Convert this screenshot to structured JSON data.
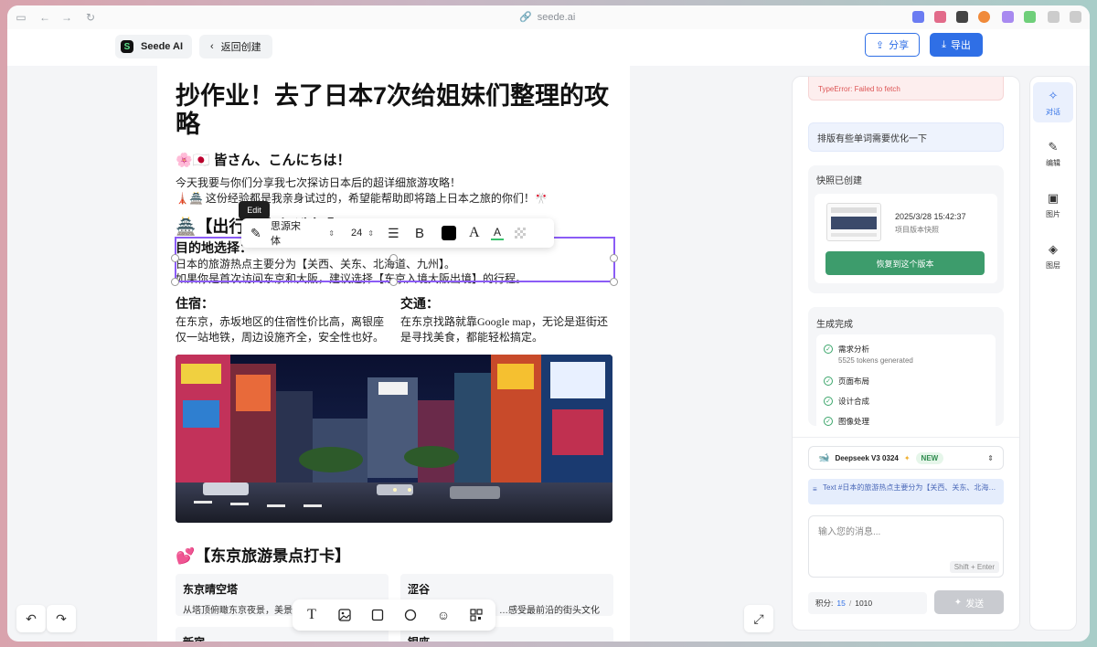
{
  "browser": {
    "url": "seede.ai"
  },
  "header": {
    "brand": "Seede AI",
    "back_label": "返回创建",
    "share_label": "分享",
    "export_label": "导出"
  },
  "doc": {
    "title": "抄作业！去了日本7次给姐妹们整理的攻略",
    "greeting": "🌸🇯🇵 皆さん、こんにちは！",
    "intro_line1": "今天我要与你们分享我七次探访日本后的超详细旅游攻略！",
    "intro_line2": "🗼🏯 这份经验都是我亲身试过的，希望能帮助即将踏上日本之旅的你们！🎌",
    "section1_title": "🏯【出行…之行选择】",
    "dest_heading": "目的地选择：",
    "dest_line1": "日本的旅游热点主要分为【关西、关东、北海道、九州】。",
    "dest_line2": "如果你是首次访问东京和大阪，建议选择【东京入境大阪出境】的行程。",
    "stay_heading": "住宿：",
    "stay_text": "在东京，赤坂地区的住宿性价比高，离银座仅一站地铁，周边设施齐全，安全性也好。",
    "transport_heading": "交通：",
    "transport_text": "在东京找路就靠Google map，无论是逛街还是寻找美食，都能轻松搞定。",
    "section2_title": "💕【东京旅游景点打卡】",
    "cards": [
      {
        "title": "东京晴空塔",
        "desc": "从塔顶俯瞰东京夜景，美景令人震撼"
      },
      {
        "title": "涩谷",
        "desc": "…感受最前沿的街头文化"
      },
      {
        "title": "新宿",
        "desc": ""
      },
      {
        "title": "银座",
        "desc": ""
      }
    ]
  },
  "format_toolbar": {
    "tooltip": "Edit",
    "font": "思源宋体",
    "size": "24",
    "bold": "B",
    "serif_a": "A",
    "color_a": "A",
    "text_color": "#000000",
    "underline_color": "#39c16c"
  },
  "insert_tools": [
    "text-tool",
    "image-tool",
    "rectangle-tool",
    "circle-tool",
    "emoji-tool",
    "qrcode-tool"
  ],
  "panel": {
    "error_text": "TypeError: Failed to fetch",
    "user_message": "排版有些单词需要优化一下",
    "snapshot": {
      "title": "快照已创建",
      "time": "2025/3/28 15:42:37",
      "subtitle": "项目版本快照",
      "restore_label": "恢复到这个版本"
    },
    "generation": {
      "title": "生成完成",
      "steps": [
        {
          "label": "需求分析",
          "sub": "5525 tokens generated"
        },
        {
          "label": "页面布局",
          "sub": ""
        },
        {
          "label": "设计合成",
          "sub": ""
        },
        {
          "label": "图像处理",
          "sub": ""
        }
      ]
    },
    "model": {
      "name": "Deepseek V3 0324",
      "badge": "NEW"
    },
    "context_chip": "Text #日本的旅游热点主要分为【关西、关东、北海…",
    "input_placeholder": "输入您的消息...",
    "shift_hint": "Shift + Enter",
    "credits_label": "积分:",
    "credits_used": "15",
    "credits_sep": "/",
    "credits_total": "1010",
    "send_label": "发送"
  },
  "side_tabs": [
    {
      "label": "对话",
      "icon": "sparkle-icon",
      "active": true
    },
    {
      "label": "编辑",
      "icon": "edit-icon",
      "active": false
    },
    {
      "label": "图片",
      "icon": "image-icon",
      "active": false
    },
    {
      "label": "图层",
      "icon": "layers-icon",
      "active": false
    }
  ]
}
